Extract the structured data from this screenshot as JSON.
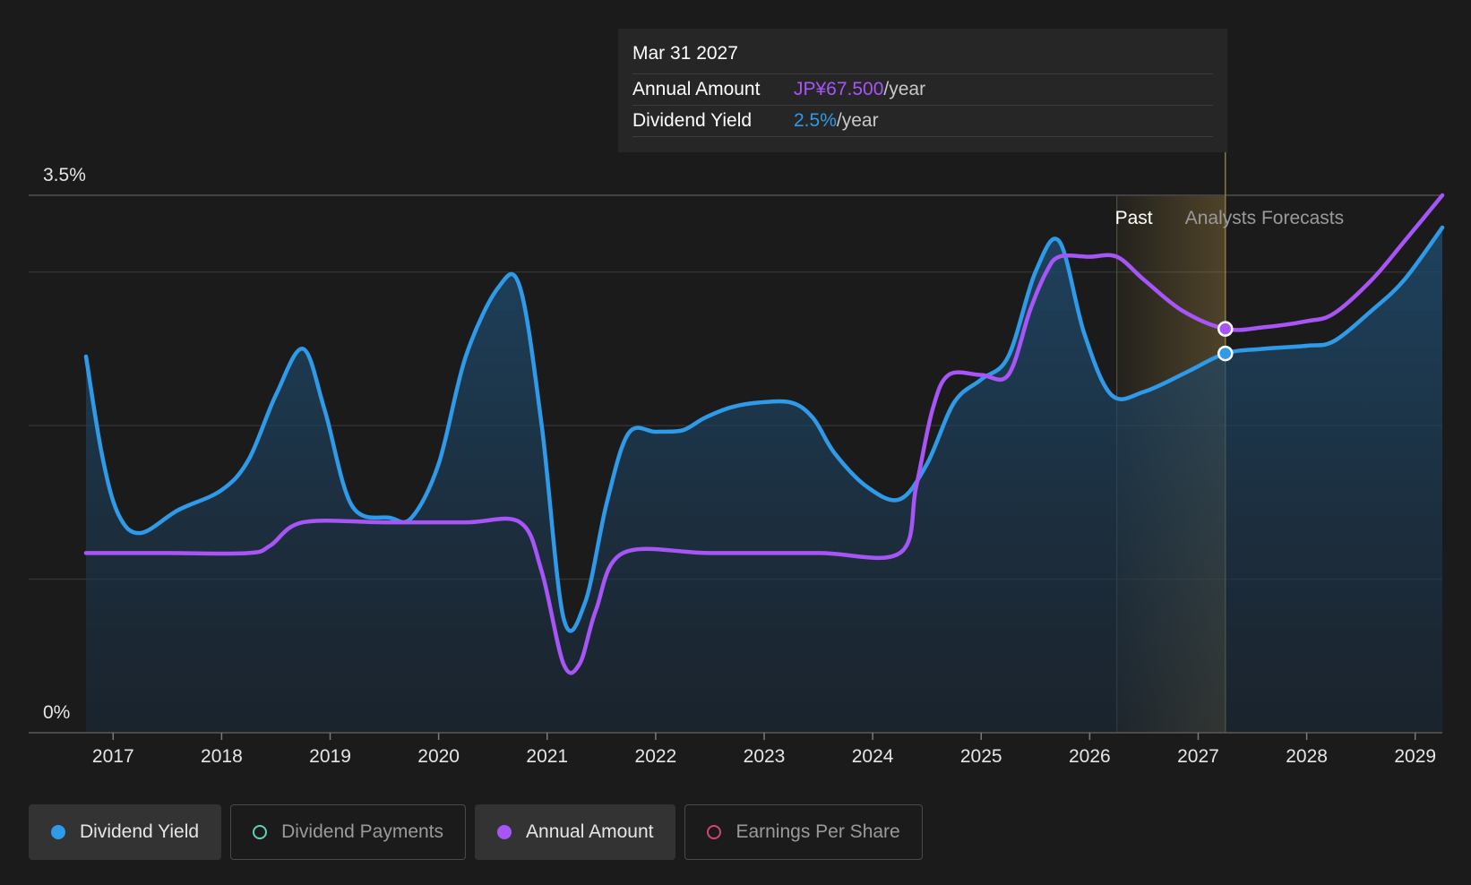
{
  "tooltip": {
    "date": "Mar 31 2027",
    "rows": [
      {
        "label": "Annual Amount",
        "value": "JP¥67.500",
        "unit": "/year"
      },
      {
        "label": "Dividend Yield",
        "value": "2.5%",
        "unit": "/year"
      }
    ]
  },
  "regions": {
    "past_label": "Past",
    "forecast_label": "Analysts Forecasts"
  },
  "legend": [
    {
      "label": "Dividend Yield",
      "color": "#2f9be8",
      "active": true,
      "marker": "filled"
    },
    {
      "label": "Dividend Payments",
      "color": "#5fd1b8",
      "active": false,
      "marker": "outline"
    },
    {
      "label": "Annual Amount",
      "color": "#a855f7",
      "active": true,
      "marker": "filled"
    },
    {
      "label": "Earnings Per Share",
      "color": "#d0457a",
      "active": false,
      "marker": "outline"
    }
  ],
  "chart_data": {
    "type": "line",
    "xlim": [
      2016.75,
      2029.25
    ],
    "ylim": [
      0,
      3.5
    ],
    "y_tick_labels": [
      {
        "value": 3.5,
        "label": "3.5%"
      },
      {
        "value": 0,
        "label": "0%"
      }
    ],
    "gridlines_y": [
      1.0,
      2.0,
      3.0,
      3.5
    ],
    "x_ticks": [
      2017,
      2018,
      2019,
      2020,
      2021,
      2022,
      2023,
      2024,
      2025,
      2026,
      2027,
      2028,
      2029
    ],
    "past_end": 2026.25,
    "highlight_x": 2027.25,
    "series": [
      {
        "name": "Dividend Yield",
        "color": "#2f9be8",
        "area": true,
        "points": [
          [
            2016.75,
            2.45
          ],
          [
            2016.9,
            1.8
          ],
          [
            2017.05,
            1.42
          ],
          [
            2017.25,
            1.3
          ],
          [
            2017.6,
            1.45
          ],
          [
            2018.0,
            1.58
          ],
          [
            2018.25,
            1.78
          ],
          [
            2018.5,
            2.2
          ],
          [
            2018.75,
            2.5
          ],
          [
            2018.95,
            2.1
          ],
          [
            2019.2,
            1.48
          ],
          [
            2019.55,
            1.4
          ],
          [
            2019.75,
            1.4
          ],
          [
            2020.0,
            1.75
          ],
          [
            2020.25,
            2.45
          ],
          [
            2020.55,
            2.9
          ],
          [
            2020.75,
            2.9
          ],
          [
            2020.95,
            2.0
          ],
          [
            2021.15,
            0.75
          ],
          [
            2021.35,
            0.85
          ],
          [
            2021.55,
            1.5
          ],
          [
            2021.75,
            1.95
          ],
          [
            2022.0,
            1.96
          ],
          [
            2022.25,
            1.97
          ],
          [
            2022.45,
            2.05
          ],
          [
            2022.7,
            2.12
          ],
          [
            2022.95,
            2.15
          ],
          [
            2023.25,
            2.15
          ],
          [
            2023.45,
            2.05
          ],
          [
            2023.65,
            1.82
          ],
          [
            2023.95,
            1.6
          ],
          [
            2024.25,
            1.52
          ],
          [
            2024.5,
            1.75
          ],
          [
            2024.75,
            2.15
          ],
          [
            2025.0,
            2.3
          ],
          [
            2025.25,
            2.45
          ],
          [
            2025.5,
            3.0
          ],
          [
            2025.72,
            3.2
          ],
          [
            2025.95,
            2.6
          ],
          [
            2026.2,
            2.2
          ],
          [
            2026.5,
            2.22
          ],
          [
            2026.9,
            2.35
          ],
          [
            2027.25,
            2.47
          ],
          [
            2027.6,
            2.5
          ],
          [
            2028.0,
            2.52
          ],
          [
            2028.25,
            2.55
          ],
          [
            2028.6,
            2.75
          ],
          [
            2028.9,
            2.95
          ],
          [
            2029.25,
            3.29
          ]
        ]
      },
      {
        "name": "Annual Amount",
        "color": "#a855f7",
        "area": false,
        "points": [
          [
            2016.75,
            1.17
          ],
          [
            2017.5,
            1.17
          ],
          [
            2018.25,
            1.17
          ],
          [
            2018.45,
            1.22
          ],
          [
            2018.75,
            1.37
          ],
          [
            2019.5,
            1.37
          ],
          [
            2020.25,
            1.37
          ],
          [
            2020.75,
            1.37
          ],
          [
            2020.95,
            1.05
          ],
          [
            2021.15,
            0.45
          ],
          [
            2021.3,
            0.45
          ],
          [
            2021.45,
            0.8
          ],
          [
            2021.7,
            1.17
          ],
          [
            2022.5,
            1.17
          ],
          [
            2023.5,
            1.17
          ],
          [
            2024.25,
            1.17
          ],
          [
            2024.4,
            1.6
          ],
          [
            2024.55,
            2.1
          ],
          [
            2024.7,
            2.33
          ],
          [
            2025.0,
            2.33
          ],
          [
            2025.25,
            2.33
          ],
          [
            2025.45,
            2.75
          ],
          [
            2025.6,
            3.0
          ],
          [
            2025.72,
            3.1
          ],
          [
            2026.0,
            3.1
          ],
          [
            2026.25,
            3.1
          ],
          [
            2026.5,
            2.95
          ],
          [
            2026.85,
            2.75
          ],
          [
            2027.25,
            2.63
          ],
          [
            2027.6,
            2.64
          ],
          [
            2028.0,
            2.68
          ],
          [
            2028.25,
            2.73
          ],
          [
            2028.6,
            2.95
          ],
          [
            2028.9,
            3.2
          ],
          [
            2029.25,
            3.5
          ]
        ]
      }
    ],
    "highlight_points": [
      {
        "series": "Annual Amount",
        "x": 2027.25,
        "y": 2.63
      },
      {
        "series": "Dividend Yield",
        "x": 2027.25,
        "y": 2.47
      }
    ]
  }
}
